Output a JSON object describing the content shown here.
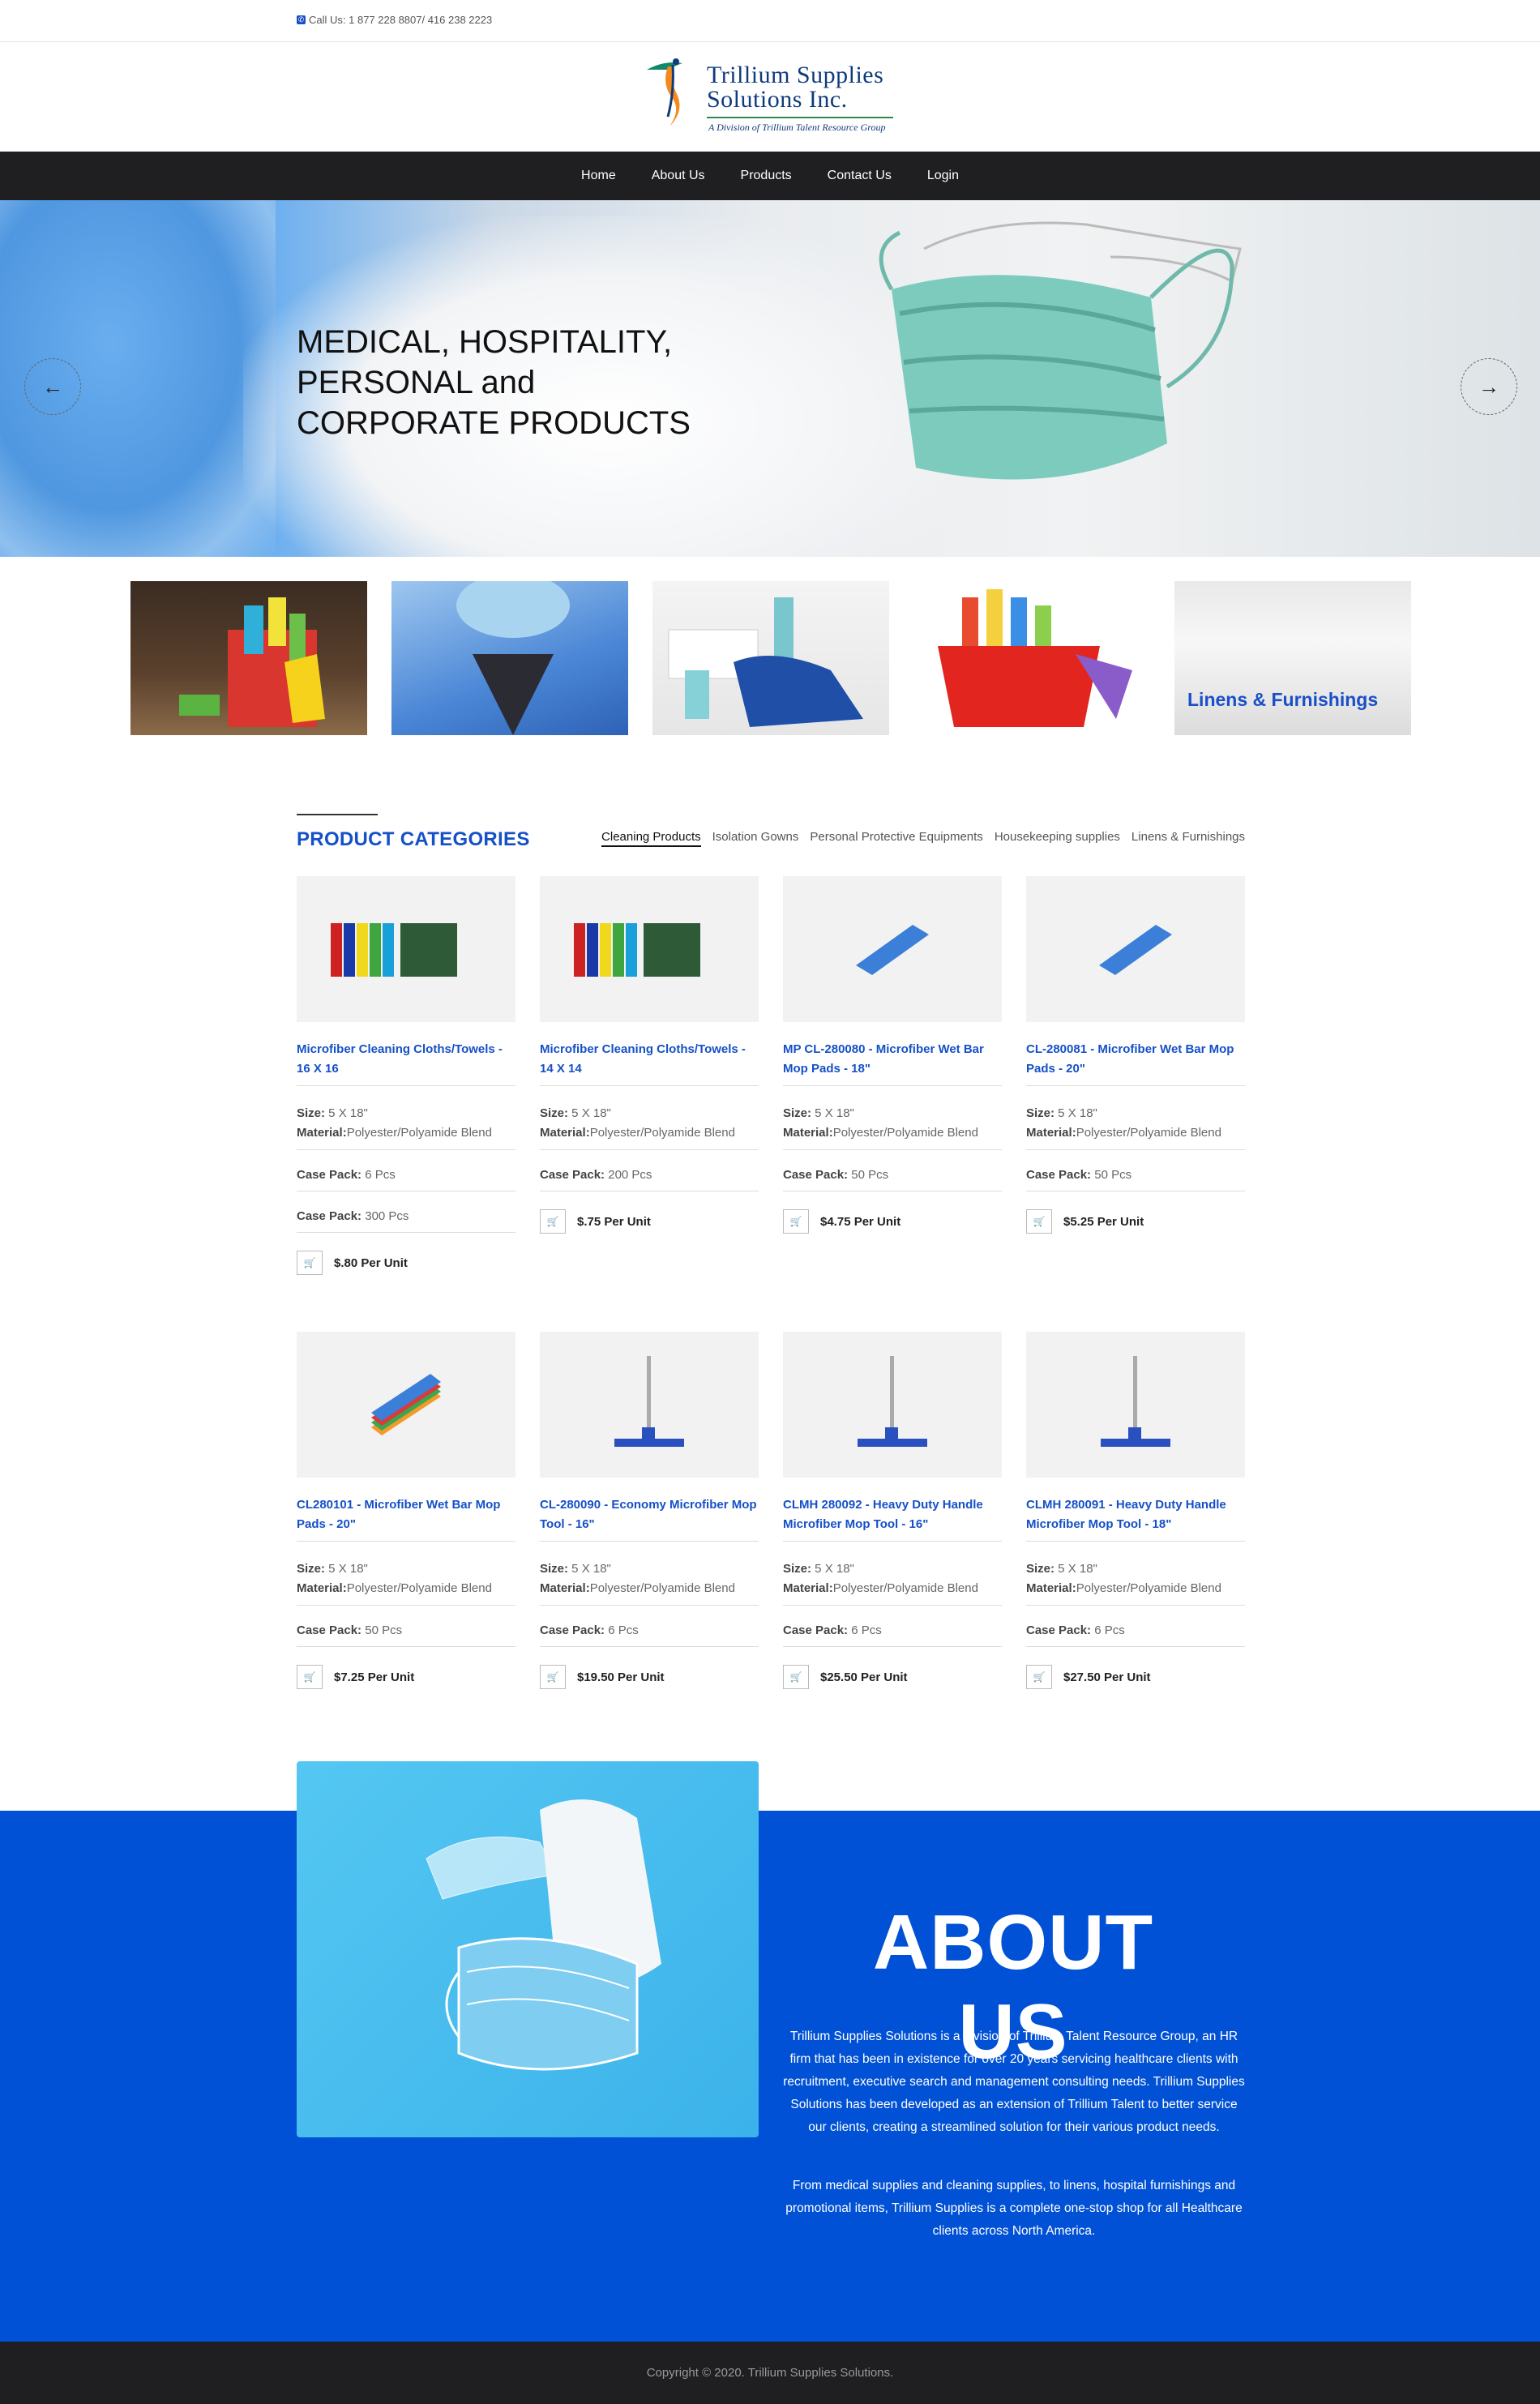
{
  "topbar": {
    "phone": "Call Us: 1 877 228 8807/ 416 238 2223"
  },
  "logo": {
    "line1": "Trillium Supplies",
    "line2": "Solutions Inc.",
    "tagline": "A Division of Trillium Talent Resource Group"
  },
  "nav": [
    {
      "label": "Home"
    },
    {
      "label": "About Us"
    },
    {
      "label": "Products"
    },
    {
      "label": "Contact Us"
    },
    {
      "label": "Login"
    }
  ],
  "hero": {
    "line1": "MEDICAL, HOSPITALITY,",
    "line2a": "PERSONAL",
    "line2b": "and",
    "line3": "CORPORATE PRODUCTS",
    "prev_icon": "arrow-left-icon",
    "next_icon": "arrow-right-icon"
  },
  "category_tiles": [
    {
      "name": "cleaning-products",
      "label": ""
    },
    {
      "name": "isolation-gowns",
      "label": ""
    },
    {
      "name": "personal-protective-equipments",
      "label": ""
    },
    {
      "name": "housekeeping-supplies",
      "label": ""
    },
    {
      "name": "linens-furnishings",
      "label": "Linens & Furnishings"
    }
  ],
  "products_section": {
    "title": "PRODUCT CATEGORIES",
    "tabs": [
      "Cleaning Products",
      "Isolation Gowns",
      "Personal Protective Equipments",
      "Housekeeping supplies",
      "Linens & Furnishings"
    ],
    "active_tab": "Cleaning Products"
  },
  "products": [
    {
      "name": "Microfiber Cleaning Cloths/Towels - 16 X 16",
      "size_label": "Size:",
      "size": " 5 X 18\"",
      "material_label": "Material:",
      "material": "Polyester/Polyamide Blend",
      "casepack_label": "Case Pack:",
      "casepack": " 6 Pcs",
      "casepack2": " 300 Pcs",
      "price": "$.80 Per Unit",
      "img": "cloths"
    },
    {
      "name": "Microfiber Cleaning Cloths/Towels - 14 X 14",
      "size_label": "Size:",
      "size": " 5 X 18\"",
      "material_label": "Material:",
      "material": "Polyester/Polyamide Blend",
      "casepack_label": "Case Pack:",
      "casepack": " 200 Pcs",
      "price": "$.75 Per Unit",
      "img": "cloths"
    },
    {
      "name": "MP CL-280080 - Microfiber Wet Bar Mop Pads - 18\"",
      "size_label": "Size:",
      "size": " 5 X 18\"",
      "material_label": "Material:",
      "material": "Polyester/Polyamide Blend",
      "casepack_label": "Case Pack:",
      "casepack": " 50 Pcs",
      "price": "$4.75 Per Unit",
      "img": "pad"
    },
    {
      "name": "CL-280081 - Microfiber Wet Bar Mop Pads - 20\"",
      "size_label": "Size:",
      "size": " 5 X 18\"",
      "material_label": "Material:",
      "material": "Polyester/Polyamide Blend",
      "casepack_label": "Case Pack:",
      "casepack": " 50 Pcs",
      "price": "$5.25 Per Unit",
      "img": "pad"
    },
    {
      "name": "CL280101 - Microfiber Wet Bar Mop Pads - 20\"",
      "size_label": "Size:",
      "size": " 5 X 18\"",
      "material_label": "Material:",
      "material": "Polyester/Polyamide Blend",
      "casepack_label": "Case Pack:",
      "casepack": " 50 Pcs",
      "price": "$7.25 Per Unit",
      "img": "pads"
    },
    {
      "name": "CL-280090 - Economy Microfiber Mop Tool - 16\"",
      "size_label": "Size:",
      "size": " 5 X 18\"",
      "material_label": "Material:",
      "material": "Polyester/Polyamide Blend",
      "casepack_label": "Case Pack:",
      "casepack": " 6 Pcs",
      "price": "$19.50 Per Unit",
      "img": "mop"
    },
    {
      "name": "CLMH 280092 - Heavy Duty Handle Microfiber Mop Tool - 16\"",
      "size_label": "Size:",
      "size": " 5 X 18\"",
      "material_label": "Material:",
      "material": "Polyester/Polyamide Blend",
      "casepack_label": "Case Pack:",
      "casepack": " 6 Pcs",
      "price": "$25.50 Per Unit",
      "img": "mop"
    },
    {
      "name": "CLMH 280091 - Heavy Duty Handle Microfiber Mop Tool - 18\"",
      "size_label": "Size:",
      "size": " 5 X 18\"",
      "material_label": "Material:",
      "material": "Polyester/Polyamide Blend",
      "casepack_label": "Case Pack:",
      "casepack": " 6 Pcs",
      "price": "$27.50 Per Unit",
      "img": "mop"
    }
  ],
  "about": {
    "title": "ABOUT US",
    "p1": "Trillium Supplies Solutions is a division of Trillium Talent Resource Group, an HR firm that has been in existence for over 20 years servicing healthcare clients with recruitment, executive search and management consulting needs. Trillium Supplies Solutions has been developed as an extension of Trillium Talent to better service our clients, creating a streamlined solution for their various product needs.",
    "p2": "From medical supplies and cleaning supplies, to linens, hospital furnishings and promotional items, Trillium Supplies is a complete one-stop shop for all Healthcare clients across North America."
  },
  "footer": {
    "copyright": "Copyright © 2020. Trillium Supplies Solutions."
  },
  "colors": {
    "brand_blue": "#1550c8",
    "about_band": "#0051d5",
    "nav_bg": "#1f1f22"
  }
}
